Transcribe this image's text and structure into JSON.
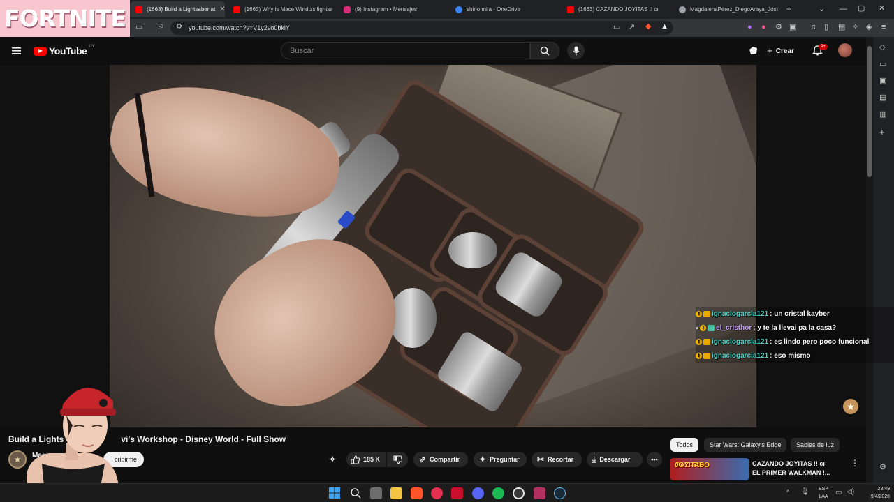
{
  "browser": {
    "tabs": [
      {
        "title": "(1663) Build a Lightsaber at",
        "favicon_color": "#ff0000",
        "active": true
      },
      {
        "title": "(1663) Why is Mace Windu's lightsa",
        "favicon_color": "#ff0000",
        "active": false
      },
      {
        "title": "(9) Instagram • Mensajes",
        "favicon_color": "#d62976",
        "active": false
      },
      {
        "title": "shino mila - OneDrive",
        "favicon_color": "#3b82f6",
        "active": false
      },
      {
        "title": "(1663) CAZANDO JOYITAS !! cı",
        "favicon_color": "#ff0000",
        "active": false
      },
      {
        "title": "MagdalenaPerez_DiegoAraya_Jose",
        "favicon_color": "#9aa0a6",
        "active": false
      }
    ],
    "new_tab_glyph": "+",
    "url": "youtube.com/watch?v=V1y2vo0bkiY"
  },
  "overlay": {
    "game_logo": "FORTNITE"
  },
  "youtube": {
    "logo_text": "YouTube",
    "country_code": "UY",
    "search_placeholder": "Buscar",
    "create_label": "Crear",
    "notification_count": "9+"
  },
  "chat": [
    {
      "user": "ignaciogarcia121",
      "user_color": "#4fd1c5",
      "message": ": un cristal kayber"
    },
    {
      "user": "el_cristhor",
      "user_color": "#c79cff",
      "message": ": y te la llevai pa la casa?"
    },
    {
      "user": "ignaciogarcia121",
      "user_color": "#4fd1c5",
      "message": ": es lindo pero poco funcional"
    },
    {
      "user": "ignaciogarcia121",
      "user_color": "#4fd1c5",
      "message": ": eso mismo"
    }
  ],
  "video": {
    "title_part1": "Build a Lights",
    "title_part2": "vi's Workshop - Disney World - Full Show",
    "channel_partial": "Magic",
    "subscribe_label": "cribirme",
    "likes": "185 K",
    "actions": {
      "share": "Compartir",
      "ask": "Preguntar",
      "clip": "Recortar",
      "download": "Descargar"
    }
  },
  "chips": [
    {
      "label": "Todos",
      "active": true
    },
    {
      "label": "Star Wars: Galaxy's Edge",
      "active": false
    },
    {
      "label": "Sables de luz",
      "active": false
    }
  ],
  "recommendation": {
    "thumb_text_1": "CAZANDO",
    "thumb_text_2": "JOYITAS",
    "title_line1": "CAZANDO JOYITAS !! cı",
    "title_line2": "EL PRIMER WALKMAN !..."
  },
  "taskbar": {
    "lang_1": "ESP",
    "lang_2": "LAA",
    "time": "23:49",
    "date": "9/4/2026"
  },
  "colors": {
    "youtube_red": "#ff0000",
    "accent_bg": "#0f0f0f",
    "fortnite_pink": "#f7c6cf"
  }
}
